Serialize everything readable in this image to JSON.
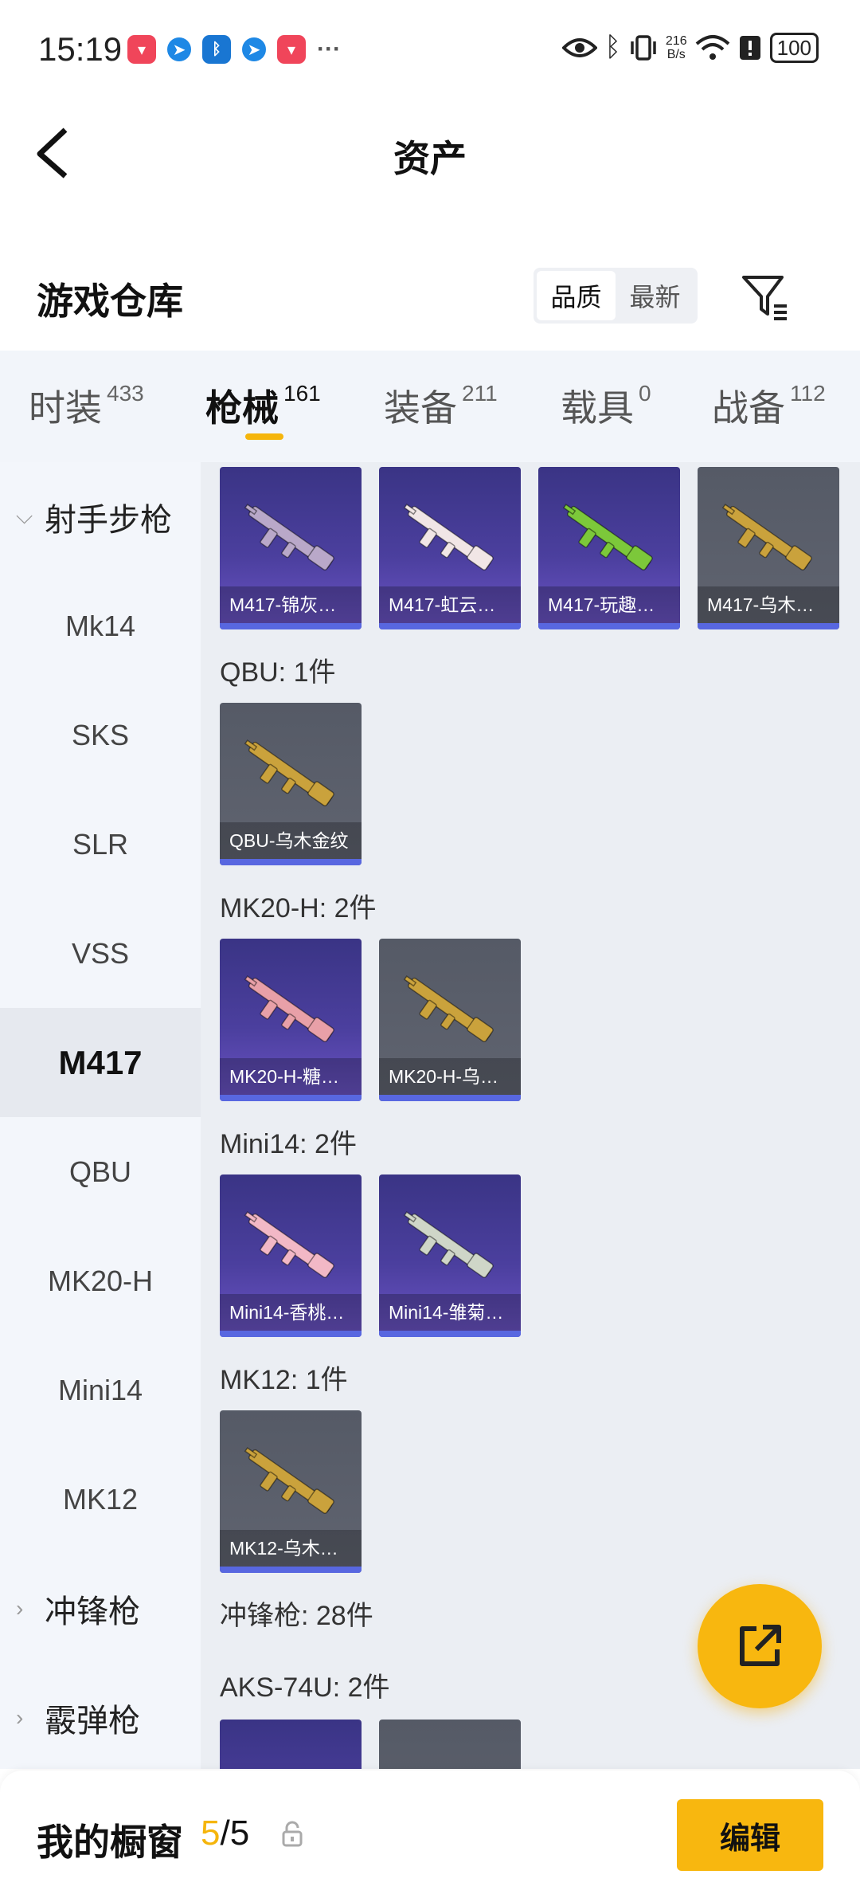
{
  "status_bar": {
    "time": "15:19",
    "net_speed_value": "216",
    "net_speed_unit": "B/s",
    "battery": "100",
    "more": "···"
  },
  "header": {
    "title": "资产"
  },
  "warehouse": {
    "title": "游戏仓库",
    "sort_options": [
      "品质",
      "最新"
    ],
    "sort_selected": "品质"
  },
  "category_tabs": [
    {
      "label": "时装",
      "count": "433"
    },
    {
      "label": "枪械",
      "count": "161",
      "active": true
    },
    {
      "label": "装备",
      "count": "211"
    },
    {
      "label": "载具",
      "count": "0"
    },
    {
      "label": "战备",
      "count": "112"
    }
  ],
  "sidebar": [
    {
      "label": "射手步枪",
      "type": "group",
      "expanded": true
    },
    {
      "label": "Mk14"
    },
    {
      "label": "SKS"
    },
    {
      "label": "SLR"
    },
    {
      "label": "VSS"
    },
    {
      "label": "M417",
      "active": true
    },
    {
      "label": "QBU"
    },
    {
      "label": "MK20-H"
    },
    {
      "label": "Mini14"
    },
    {
      "label": "MK12"
    },
    {
      "label": "冲锋枪",
      "type": "group",
      "expanded": false
    },
    {
      "label": "霰弹枪",
      "type": "group",
      "expanded": false
    }
  ],
  "content": {
    "m417_items": [
      {
        "name": "M417-锦灰…",
        "color": "#b9a8c9",
        "bg": "purple"
      },
      {
        "name": "M417-虹云…",
        "color": "#f1e6e6",
        "bg": "purple"
      },
      {
        "name": "M417-玩趣…",
        "color": "#7cc83a",
        "bg": "purple"
      },
      {
        "name": "M417-乌木…",
        "color": "#caa23c",
        "bg": "gray"
      }
    ],
    "groups": [
      {
        "title": "QBU: 1件",
        "items": [
          {
            "name": "QBU-乌木金纹",
            "color": "#caa23c",
            "bg": "gray"
          }
        ]
      },
      {
        "title": "MK20-H: 2件",
        "items": [
          {
            "name": "MK20-H-糖…",
            "color": "#e8a0a8",
            "bg": "purple"
          },
          {
            "name": "MK20-H-乌…",
            "color": "#caa23c",
            "bg": "gray"
          }
        ]
      },
      {
        "title": "Mini14: 2件",
        "items": [
          {
            "name": "Mini14-香桃…",
            "color": "#f2b8c6",
            "bg": "purple"
          },
          {
            "name": "Mini14-雏菊…",
            "color": "#cfd6c8",
            "bg": "purple"
          }
        ]
      },
      {
        "title": "MK12: 1件",
        "items": [
          {
            "name": "MK12-乌木…",
            "color": "#caa23c",
            "bg": "gray"
          }
        ]
      }
    ],
    "smg_title": "冲锋枪: 28件",
    "aks_title": "AKS-74U: 2件"
  },
  "bottom_bar": {
    "title": "我的橱窗",
    "count_current": "5",
    "count_total": "/5",
    "edit_label": "编辑"
  },
  "colors": {
    "accent": "#f8b70f",
    "rarity_blue": "#5867e0"
  }
}
